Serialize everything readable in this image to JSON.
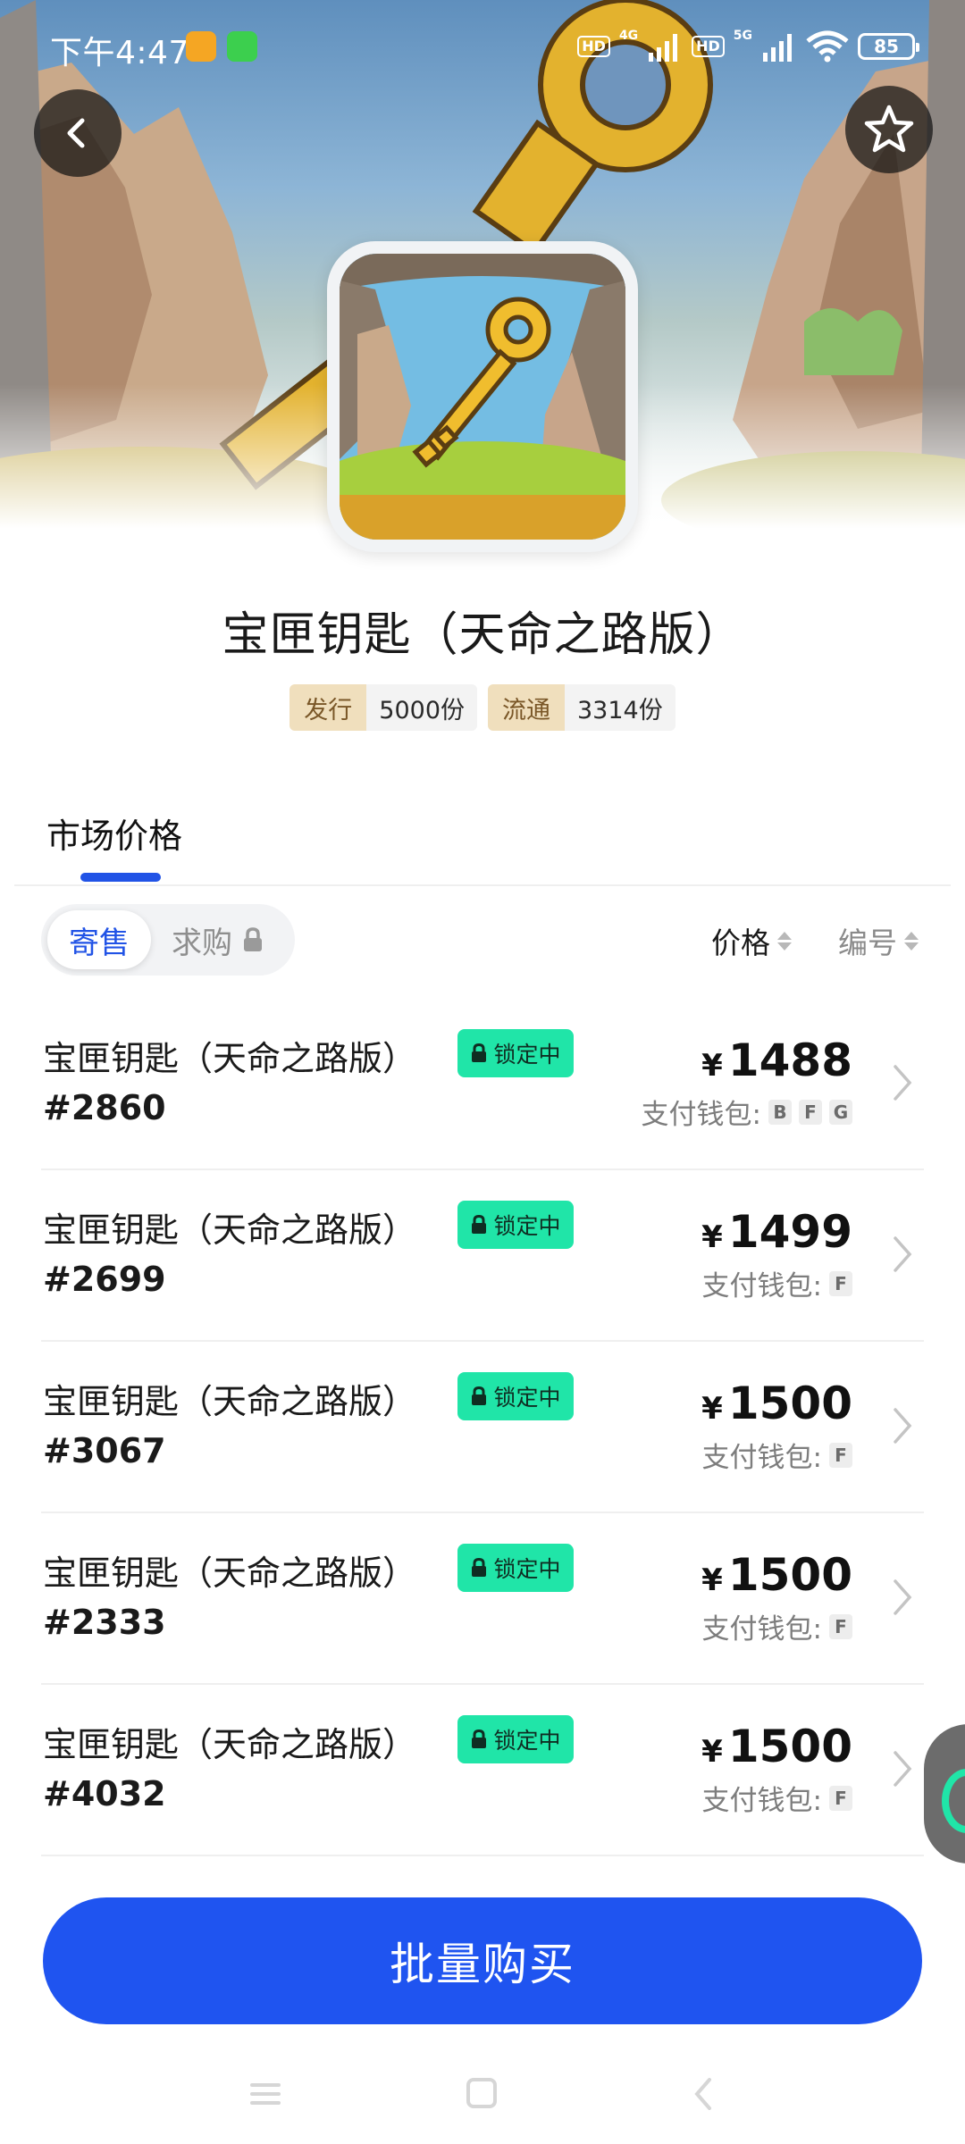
{
  "status_bar": {
    "time": "下午4:47",
    "hd_badge": "HD",
    "net_1": "4G",
    "net_2": "5G",
    "battery": "85"
  },
  "header": {
    "back_icon": "chevron-left-icon",
    "favorite_icon": "star-outline-icon"
  },
  "product": {
    "title": "宝匣钥匙（天命之路版）",
    "stats": [
      {
        "label": "发行",
        "value": "5000份"
      },
      {
        "label": "流通",
        "value": "3314份"
      }
    ]
  },
  "market": {
    "tab_label": "市场价格",
    "toggle": {
      "sell": "寄售",
      "buy": "求购"
    },
    "sort": {
      "price": "价格",
      "number": "编号"
    }
  },
  "listings": [
    {
      "name": "宝匣钥匙（天命之路版）",
      "serial": "#2860",
      "status": "锁定中",
      "currency": "¥",
      "price": "1488",
      "wallet_label": "支付钱包:",
      "wallets": [
        "B",
        "F",
        "G"
      ]
    },
    {
      "name": "宝匣钥匙（天命之路版）",
      "serial": "#2699",
      "status": "锁定中",
      "currency": "¥",
      "price": "1499",
      "wallet_label": "支付钱包:",
      "wallets": [
        "F"
      ]
    },
    {
      "name": "宝匣钥匙（天命之路版）",
      "serial": "#3067",
      "status": "锁定中",
      "currency": "¥",
      "price": "1500",
      "wallet_label": "支付钱包:",
      "wallets": [
        "F"
      ]
    },
    {
      "name": "宝匣钥匙（天命之路版）",
      "serial": "#2333",
      "status": "锁定中",
      "currency": "¥",
      "price": "1500",
      "wallet_label": "支付钱包:",
      "wallets": [
        "F"
      ]
    },
    {
      "name": "宝匣钥匙（天命之路版）",
      "serial": "#4032",
      "status": "锁定中",
      "currency": "¥",
      "price": "1500",
      "wallet_label": "支付钱包:",
      "wallets": [
        "F"
      ]
    }
  ],
  "buy_button": "批量购买",
  "colors": {
    "accent": "#1f54f0",
    "lock_badge": "#20e5a8",
    "stat_key_bg": "#f0dfbd"
  }
}
